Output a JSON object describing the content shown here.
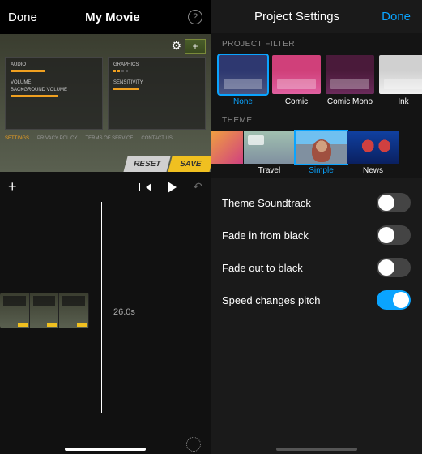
{
  "left": {
    "header": {
      "done": "Done",
      "title": "My Movie",
      "help": "?"
    },
    "game": {
      "panel1_label": "AUDIO",
      "panel2_label": "GRAPHICS",
      "sub1": "VOLUME",
      "sub2": "BACKGROUND VOLUME",
      "sub3": "SENSITIVITY",
      "tabs": [
        "SETTINGS",
        "PRIVACY POLICY",
        "TERMS OF SERVICE",
        "CONTACT US"
      ],
      "reset": "RESET",
      "save": "SAVE"
    },
    "timeline": {
      "time": "26.0s"
    }
  },
  "right": {
    "header": {
      "title": "Project Settings",
      "done": "Done"
    },
    "filter_section": "PROJECT FILTER",
    "filters": [
      {
        "name": "None",
        "selected": true
      },
      {
        "name": "Comic",
        "selected": false
      },
      {
        "name": "Comic Mono",
        "selected": false
      },
      {
        "name": "Ink",
        "selected": false
      }
    ],
    "theme_section": "THEME",
    "themes": [
      {
        "name": "Travel",
        "selected": false
      },
      {
        "name": "Simple",
        "selected": true
      },
      {
        "name": "News",
        "selected": false
      }
    ],
    "toggles": [
      {
        "label": "Theme Soundtrack",
        "on": false
      },
      {
        "label": "Fade in from black",
        "on": false
      },
      {
        "label": "Fade out to black",
        "on": false
      },
      {
        "label": "Speed changes pitch",
        "on": true
      }
    ]
  }
}
